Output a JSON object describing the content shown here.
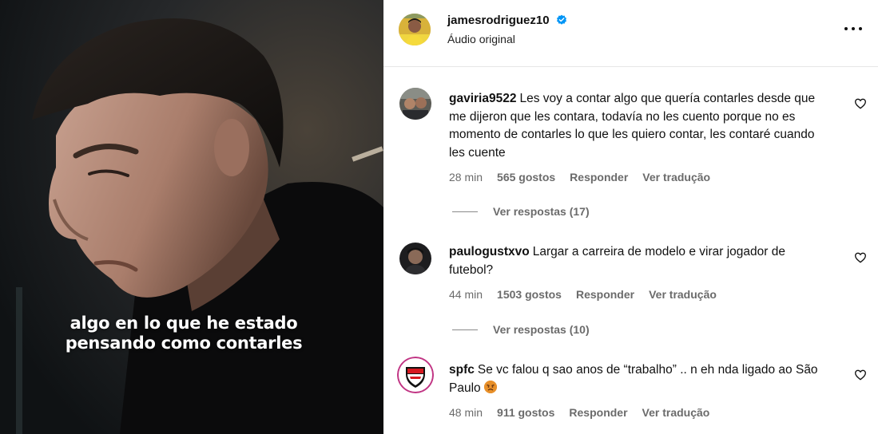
{
  "video": {
    "caption_line1": "algo en lo que he estado",
    "caption_line2": "pensando como contarles"
  },
  "header": {
    "username": "jamesrodriguez10",
    "audio_label": "Áudio original",
    "more_icon": "more-horizontal-icon"
  },
  "comments": [
    {
      "user": "gaviria9522",
      "text": "Les voy a contar algo que quería contarles desde que me dijeron que les contara, todavía no les cuento porque no es momento de contarles lo que les quiero contar, les contaré cuando les cuente",
      "time": "28 min",
      "likes": "565 gostos",
      "reply": "Responder",
      "translate": "Ver tradução",
      "replies": "Ver respostas (17)"
    },
    {
      "user": "paulogustxvo",
      "text": "Largar a carreira de modelo e virar jogador de futebol?",
      "time": "44 min",
      "likes": "1503 gostos",
      "reply": "Responder",
      "translate": "Ver tradução",
      "replies": "Ver respostas (10)"
    },
    {
      "user": "spfc",
      "text": "Se vc falou q sao anos de “trabalho” .. n eh nda ligado ao São Paulo",
      "emoji": "angry-face-emoji",
      "time": "48 min",
      "likes": "911 gostos",
      "reply": "Responder",
      "translate": "Ver tradução"
    }
  ],
  "colors": {
    "verified": "#0095f6",
    "muted_text": "#6b6b6b",
    "spfc_red": "#d71920"
  }
}
